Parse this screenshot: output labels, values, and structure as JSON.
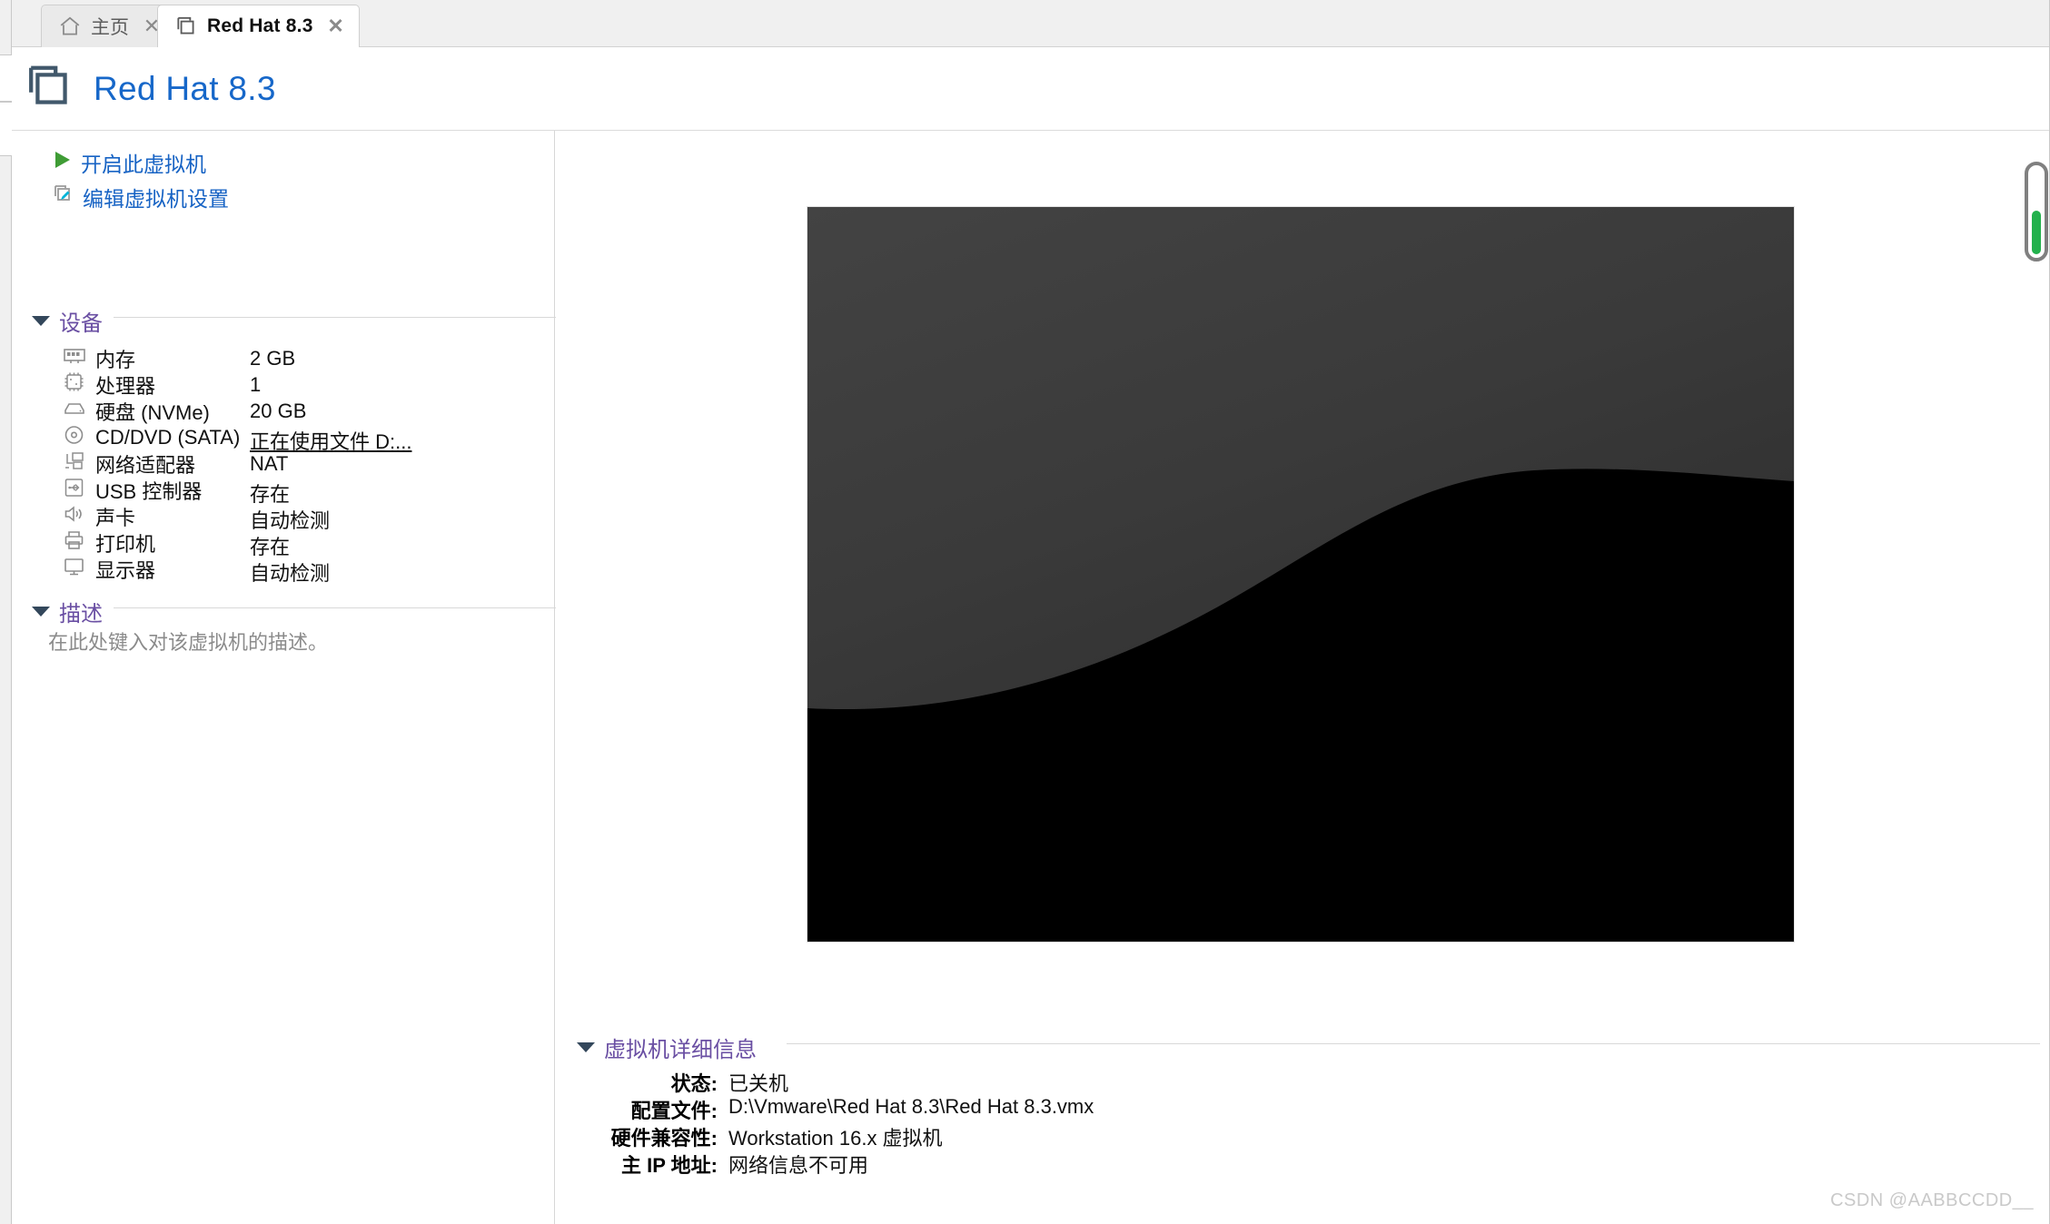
{
  "window": {
    "tabs": [
      {
        "id": "home",
        "label": "主页",
        "icon": "home-icon",
        "active": false,
        "close_glyph": "✕"
      },
      {
        "id": "vm",
        "label": "Red Hat 8.3",
        "icon": "vm-icon",
        "active": true,
        "close_glyph": "✕"
      }
    ]
  },
  "header": {
    "title": "Red Hat 8.3",
    "icon": "vm-icon",
    "title_color": "#1667c9"
  },
  "actions": [
    {
      "id": "power-on",
      "label": "开启此虚拟机",
      "icon": "play-icon",
      "icon_color": "#3f9c35"
    },
    {
      "id": "edit-settings",
      "label": "编辑虚拟机设置",
      "icon": "edit-vm-icon",
      "icon_color": "#00b4d8"
    }
  ],
  "devices_section": {
    "title": "设备",
    "expanded": true,
    "collapse_icon": "triangle-down-icon",
    "rows": [
      {
        "icon": "memory-icon",
        "name": "内存",
        "value": "2 GB"
      },
      {
        "icon": "cpu-icon",
        "name": "处理器",
        "value": "1"
      },
      {
        "icon": "harddisk-icon",
        "name": "硬盘 (NVMe)",
        "value": "20 GB"
      },
      {
        "icon": "cd-icon",
        "name": "CD/DVD (SATA)",
        "value": "正在使用文件 D:...",
        "underline": true
      },
      {
        "icon": "network-icon",
        "name": "网络适配器",
        "value": "NAT"
      },
      {
        "icon": "usb-icon",
        "name": "USB 控制器",
        "value": "存在"
      },
      {
        "icon": "sound-icon",
        "name": "声卡",
        "value": "自动检测"
      },
      {
        "icon": "printer-icon",
        "name": "打印机",
        "value": "存在"
      },
      {
        "icon": "display-icon",
        "name": "显示器",
        "value": "自动检测"
      }
    ]
  },
  "description_section": {
    "title": "描述",
    "expanded": true,
    "collapse_icon": "triangle-down-icon",
    "placeholder": "在此处键入对该虚拟机的描述。"
  },
  "details_section": {
    "title": "虚拟机详细信息",
    "expanded": true,
    "collapse_icon": "triangle-down-icon",
    "rows": [
      {
        "label": "状态:",
        "value": "已关机"
      },
      {
        "label": "配置文件:",
        "value": "D:\\Vmware\\Red Hat 8.3\\Red Hat 8.3.vmx"
      },
      {
        "label": "硬件兼容性:",
        "value": "Workstation 16.x 虚拟机"
      },
      {
        "label": "主 IP 地址:",
        "value": "网络信息不可用"
      }
    ]
  },
  "preview": {
    "alt": "虚拟机屏幕预览",
    "background_color": "#000000",
    "accent_color": "#3a3a3a"
  },
  "scrollbar": {
    "indicator_color": "#22b14c",
    "track_color": "#808080"
  },
  "watermark": {
    "text": "CSDN @AABBCCDD__"
  }
}
